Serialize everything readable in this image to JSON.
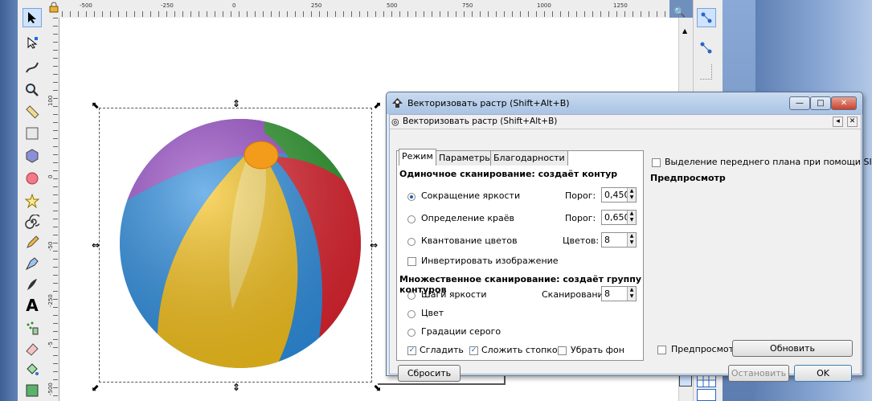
{
  "rulers": {
    "h_labels": [
      "-500",
      "-250",
      "0",
      "250",
      "500",
      "750",
      "1000",
      "1250"
    ],
    "v_labels": [
      "100",
      "0",
      "-50",
      "-250",
      "-5",
      "-500",
      "-5",
      "-750"
    ]
  },
  "toolbox": {
    "tools": [
      {
        "name": "selector-tool-icon",
        "glyph": "➤",
        "selected": true
      },
      {
        "name": "node-tool-icon",
        "glyph": "↖"
      },
      {
        "name": "tweak-tool-icon",
        "glyph": "ʆ"
      },
      {
        "name": "zoom-tool-icon",
        "glyph": "🔍"
      },
      {
        "name": "measure-tool-icon",
        "glyph": "📏"
      },
      {
        "name": "rectangle-tool-icon",
        "glyph": "▢"
      },
      {
        "name": "3d-box-tool-icon",
        "glyph": "⬢"
      },
      {
        "name": "ellipse-tool-icon",
        "glyph": "●"
      },
      {
        "name": "star-tool-icon",
        "glyph": "☆"
      },
      {
        "name": "spiral-tool-icon",
        "glyph": "@"
      },
      {
        "name": "pencil-tool-icon",
        "glyph": "✎"
      },
      {
        "name": "pen-tool-icon",
        "glyph": "✒"
      },
      {
        "name": "calligraphy-tool-icon",
        "glyph": "℘"
      },
      {
        "name": "text-tool-icon",
        "glyph": "A"
      },
      {
        "name": "spray-tool-icon",
        "glyph": "⁂"
      },
      {
        "name": "eraser-tool-icon",
        "glyph": "◇"
      },
      {
        "name": "paint-bucket-tool-icon",
        "glyph": "⛁"
      },
      {
        "name": "gradient-tool-icon",
        "glyph": "▨"
      }
    ]
  },
  "dialog": {
    "title": "Векторизовать растр (Shift+Alt+B)",
    "subtitle": "Векторизовать растр (Shift+Alt+B)",
    "tabs": [
      "Режим",
      "Параметры",
      "Благодарности"
    ],
    "single_scan": {
      "title": "Одиночное сканирование: создаёт контур",
      "options": [
        {
          "label": "Сокращение яркости",
          "param_label": "Порог:",
          "value": "0,450",
          "selected": true
        },
        {
          "label": "Определение краёв",
          "param_label": "Порог:",
          "value": "0,650",
          "selected": false
        },
        {
          "label": "Квантование цветов",
          "param_label": "Цветов:",
          "value": "8",
          "selected": false
        }
      ],
      "invert_label": "Инвертировать изображение"
    },
    "multi_scan": {
      "title": "Множественное сканирование: создаёт группу контуров",
      "options": [
        {
          "label": "Шаги яркости",
          "param_label": "Сканирований:",
          "value": "8",
          "selected": false
        },
        {
          "label": "Цвет",
          "selected": false
        },
        {
          "label": "Градации серого",
          "selected": false
        }
      ],
      "smooth_label": "Сгладить",
      "smooth_checked": true,
      "stack_label": "Сложить стопкой",
      "stack_checked": true,
      "remove_bg_label": "Убрать фон",
      "remove_bg_checked": false
    },
    "siox_label": "Выделение переднего плана при помощи SIOX",
    "preview_title": "Предпросмотр",
    "preview_check_label": "Предпросмотр",
    "refresh_button": "Обновить",
    "reset_button": "Сбросить",
    "stop_button": "Остановить",
    "ok_button": "OK"
  }
}
